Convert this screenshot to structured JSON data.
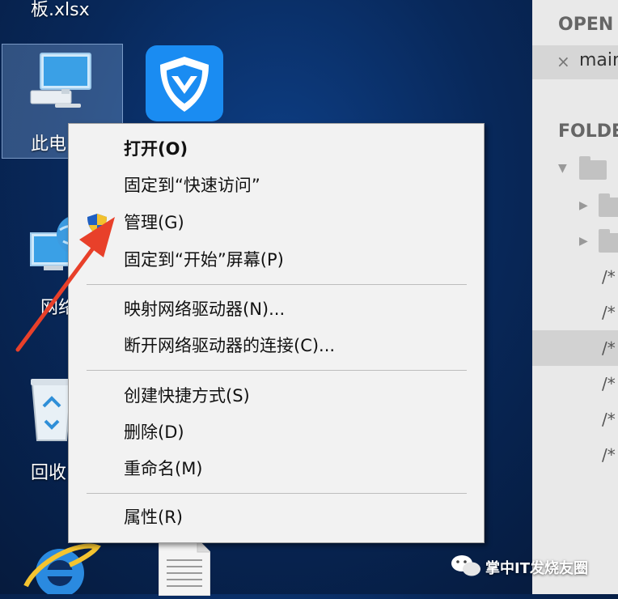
{
  "desktop": {
    "top_file_label": "板.xlsx",
    "icons": [
      {
        "label": "此电",
        "icon": "this-pc-icon"
      },
      {
        "label": "",
        "icon": "tencent-guard-icon"
      },
      {
        "label": "网络",
        "icon": "network-icon"
      },
      {
        "label": "回收",
        "icon": "recycle-bin-icon"
      },
      {
        "label": "",
        "icon": "internet-explorer-icon"
      },
      {
        "label": "",
        "icon": "text-document-icon"
      }
    ]
  },
  "context_menu": {
    "items": [
      {
        "label": "打开(O)",
        "bold": true
      },
      {
        "label": "固定到“快速访问”"
      },
      {
        "label": "管理(G)",
        "icon": "uac-shield-icon"
      },
      {
        "label": "固定到“开始”屏幕(P)"
      },
      {
        "label": "映射网络驱动器(N)..."
      },
      {
        "label": "断开网络驱动器的连接(C)..."
      },
      {
        "label": "创建快捷方式(S)"
      },
      {
        "label": "删除(D)"
      },
      {
        "label": "重命名(M)"
      },
      {
        "label": "属性(R)"
      }
    ]
  },
  "editor_panel": {
    "open_header": "OPEN",
    "open_file": "main",
    "close_glyph": "×",
    "folders_header": "FOLDE",
    "file_rows": [
      "/*",
      "/*",
      "/*",
      "/*",
      "/*",
      "/*"
    ]
  },
  "annotation": {
    "arrow_color": "#e8402a",
    "icon": "red-arrow-icon"
  },
  "watermark": {
    "text": "掌中IT发烧友圈",
    "icon": "wechat-icon"
  }
}
